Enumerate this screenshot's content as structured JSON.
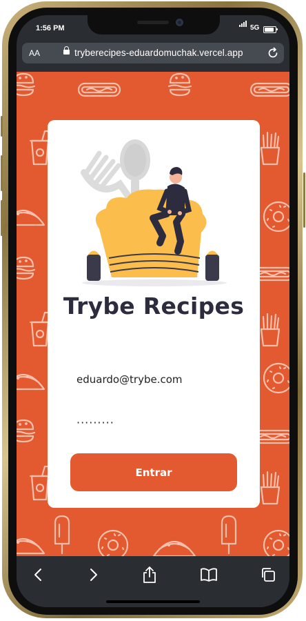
{
  "status_bar": {
    "time": "1:56 PM",
    "network": "5G"
  },
  "browser": {
    "text_size_label": "AA",
    "url": "tryberecipes-eduardomuchak.vercel.app"
  },
  "login": {
    "title": "Trybe Recipes",
    "email_value": "eduardo@trybe.com",
    "password_value": "·········",
    "submit_label": "Entrar"
  },
  "icons": {
    "lock": "lock-icon",
    "reload": "reload-icon",
    "back": "chevron-left-icon",
    "forward": "chevron-right-icon",
    "share": "share-icon",
    "bookmarks": "book-icon",
    "tabs": "tabs-icon"
  },
  "colors": {
    "brand": "#e35a30",
    "title": "#2c2c3e",
    "hat": "#fbbd4b",
    "browser_chrome": "#2a2e33"
  }
}
